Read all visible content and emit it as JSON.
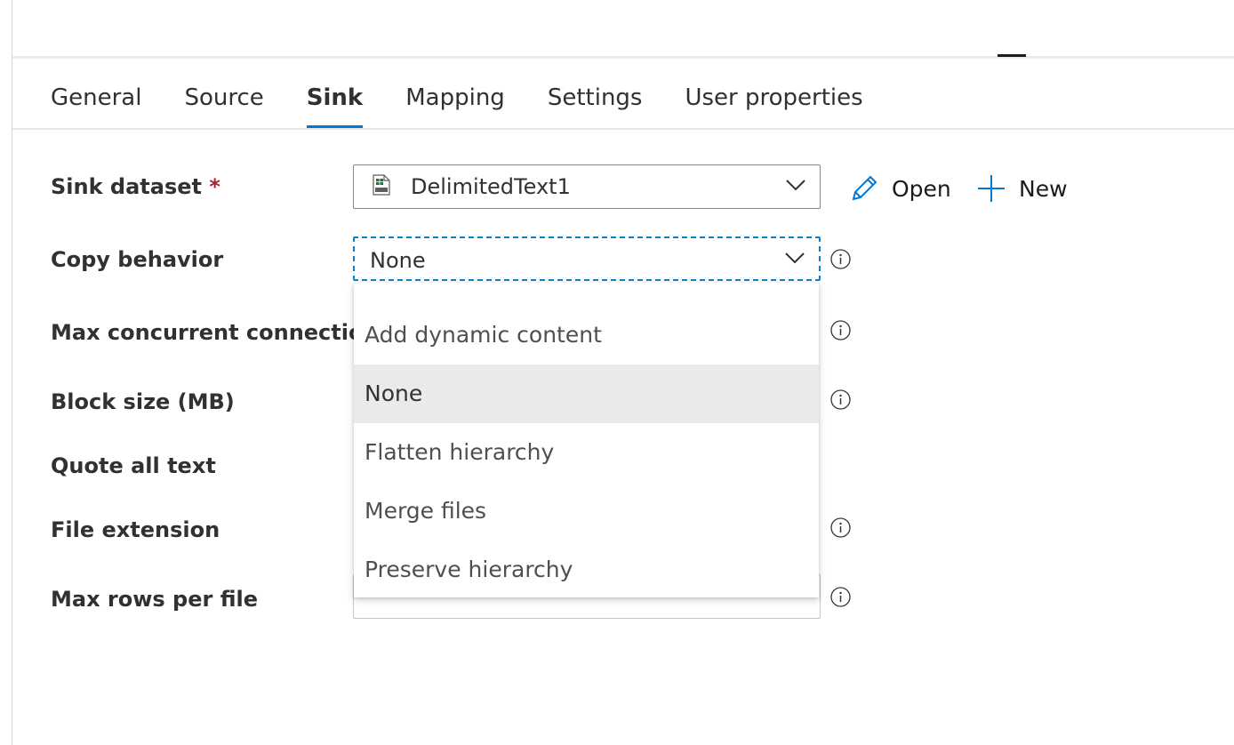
{
  "tabs": [
    {
      "label": "General"
    },
    {
      "label": "Source"
    },
    {
      "label": "Sink"
    },
    {
      "label": "Mapping"
    },
    {
      "label": "Settings"
    },
    {
      "label": "User properties"
    }
  ],
  "active_tab": "Sink",
  "fields": {
    "sink_dataset": {
      "label": "Sink dataset",
      "required_mark": "*",
      "value": "DelimitedText1",
      "icon": "csv-file-icon"
    },
    "copy_behavior": {
      "label": "Copy behavior",
      "value": "None"
    },
    "max_concurrent_connections": {
      "label": "Max concurrent connections"
    },
    "block_size": {
      "label": "Block size (MB)"
    },
    "quote_all_text": {
      "label": "Quote all text"
    },
    "file_extension": {
      "label": "File extension"
    },
    "max_rows_per_file": {
      "label": "Max rows per file"
    }
  },
  "actions": {
    "open_label": "Open",
    "new_label": "New"
  },
  "dropdown": {
    "options": [
      {
        "label": "Add dynamic content"
      },
      {
        "label": "None",
        "selected": true
      },
      {
        "label": "Flatten hierarchy"
      },
      {
        "label": "Merge files"
      },
      {
        "label": "Preserve hierarchy"
      }
    ]
  },
  "colors": {
    "accent": "#0078d4",
    "required": "#a4262c",
    "selected_option_bg": "#ebeae8"
  }
}
